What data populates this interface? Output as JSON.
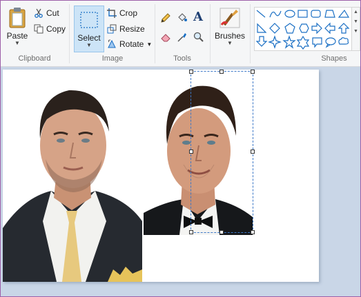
{
  "clipboard": {
    "paste_label": "Paste",
    "cut_label": "Cut",
    "copy_label": "Copy",
    "group_label": "Clipboard"
  },
  "image": {
    "select_label": "Select",
    "crop_label": "Crop",
    "resize_label": "Resize",
    "rotate_label": "Rotate",
    "group_label": "Image"
  },
  "tools": {
    "group_label": "Tools",
    "text_glyph": "A"
  },
  "brushes": {
    "label": "Brushes"
  },
  "shapes": {
    "group_label": "Shapes"
  },
  "canvas": {
    "background": "#ffffff",
    "photos": [
      "portrait-left",
      "portrait-right"
    ],
    "selection": "rectangular selection over right portrait"
  },
  "colors": {
    "accent": "#1a6fc4",
    "select_highlight": "#cce4f7",
    "canvas_bg": "#c9d6e7"
  }
}
